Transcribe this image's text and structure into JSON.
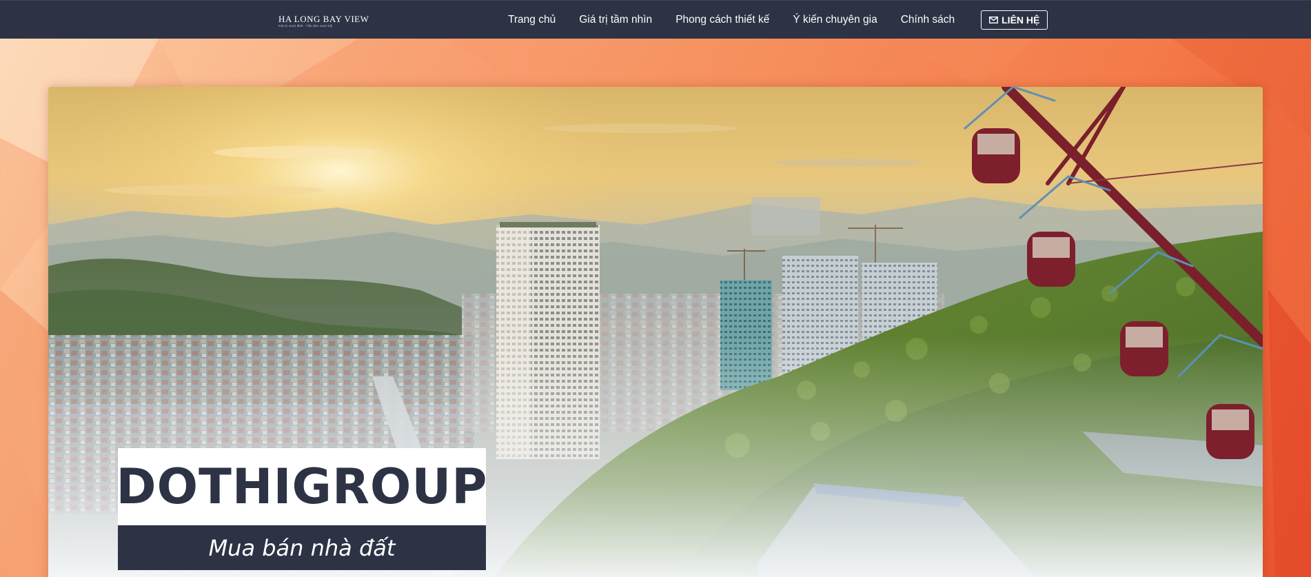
{
  "header": {
    "logo": {
      "title": "HA LONG BAY VIEW",
      "tagline": "Giá trị vượt đỉnh · Tận tâm vượt trội"
    },
    "menu": [
      {
        "label": "Trang chủ",
        "name": "nav-trang-chu"
      },
      {
        "label": "Giá trị tầm nhìn",
        "name": "nav-gia-tri-tam-nhin"
      },
      {
        "label": "Phong cách thiết kế",
        "name": "nav-phong-cach-thiet-ke"
      },
      {
        "label": "Ý kiến chuyên gia",
        "name": "nav-y-kien-chuyen-gia"
      },
      {
        "label": "Chính sách",
        "name": "nav-chinh-sach"
      }
    ],
    "contact_button": {
      "label": "LIÊN HỆ",
      "icon": "envelope-icon"
    }
  },
  "hero": {
    "brand": "DOTHIGROUP",
    "tagline": "Mua bán nhà đất"
  },
  "colors": {
    "navbar": "#2d3345",
    "brand_text": "#2d3345",
    "background_orange": "#f47a49"
  }
}
